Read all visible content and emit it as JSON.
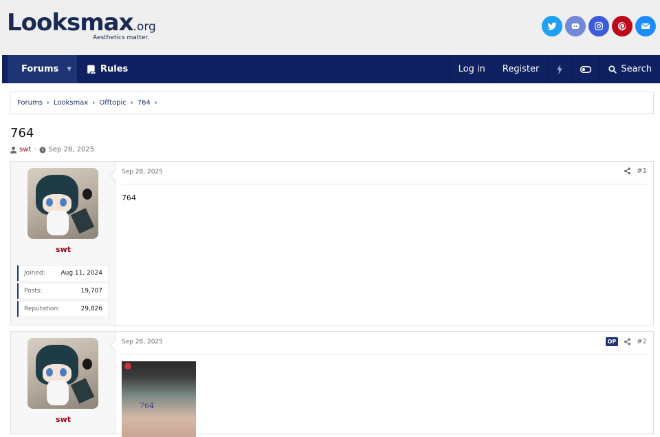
{
  "site": {
    "logo_text": "Looksmax",
    "logo_suffix": ".org",
    "tagline": "Aesthetics matter.",
    "socials": [
      {
        "name": "twitter-icon",
        "color": "#1da1f2"
      },
      {
        "name": "discord-icon",
        "color": "#7289da"
      },
      {
        "name": "instagram-icon",
        "color": "#3b5bdb"
      },
      {
        "name": "pinterest-icon",
        "color": "#bd081c"
      },
      {
        "name": "email-icon",
        "color": "#1a8cff"
      }
    ]
  },
  "nav": {
    "forums": "Forums",
    "rules": "Rules",
    "login": "Log in",
    "register": "Register",
    "search": "Search"
  },
  "breadcrumb": [
    "Forums",
    "Looksmax",
    "Offtopic",
    "764"
  ],
  "thread": {
    "title": "764",
    "author": "swt",
    "date": "Sep 28, 2025"
  },
  "posts": [
    {
      "user": "swt",
      "joined_label": "Joined:",
      "joined": "Aug 11, 2024",
      "posts_label": "Posts:",
      "posts": "19,707",
      "rep_label": "Reputation:",
      "reputation": "29,826",
      "date": "Sep 28, 2025",
      "number": "#1",
      "body": "764"
    },
    {
      "user": "swt",
      "date": "Sep 28, 2025",
      "number": "#2",
      "op_badge": "OP",
      "image_text": "764"
    }
  ],
  "colors": {
    "brand_navy": "#0f2160",
    "username_red": "#a0051c"
  }
}
